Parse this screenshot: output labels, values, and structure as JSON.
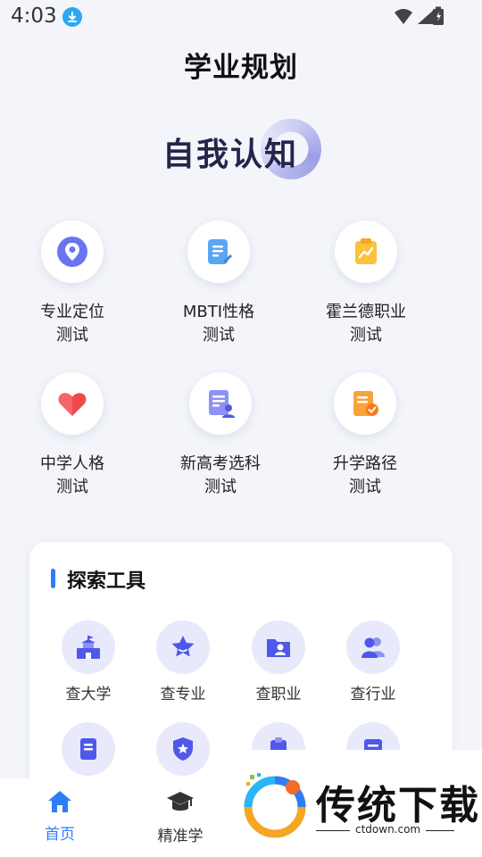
{
  "status": {
    "time": "4:03"
  },
  "page": {
    "title": "学业规划"
  },
  "hero": {
    "text": "自我认知"
  },
  "tests": [
    {
      "label1": "专业定位",
      "label2": "测试",
      "icon": "location-pin-icon"
    },
    {
      "label1": "MBTI性格",
      "label2": "测试",
      "icon": "document-edit-icon"
    },
    {
      "label1": "霍兰德职业",
      "label2": "测试",
      "icon": "clipboard-chart-icon"
    },
    {
      "label1": "中学人格",
      "label2": "测试",
      "icon": "heart-icon"
    },
    {
      "label1": "新高考选科",
      "label2": "测试",
      "icon": "document-person-icon"
    },
    {
      "label1": "升学路径",
      "label2": "测试",
      "icon": "clipboard-check-icon"
    }
  ],
  "tools": {
    "heading": "探索工具",
    "items": [
      {
        "label": "查大学",
        "icon": "university-icon"
      },
      {
        "label": "查专业",
        "icon": "star-badge-icon"
      },
      {
        "label": "查职业",
        "icon": "folder-person-icon"
      },
      {
        "label": "查行业",
        "icon": "people-icon"
      }
    ]
  },
  "nav": {
    "home": "首页",
    "precise": "精准学"
  },
  "watermark": {
    "brand": "传统下载",
    "url": "ctdown.com"
  },
  "colors": {
    "accent": "#2f7df6",
    "indigo": "#4f58e8",
    "background": "#f3f5fa"
  }
}
